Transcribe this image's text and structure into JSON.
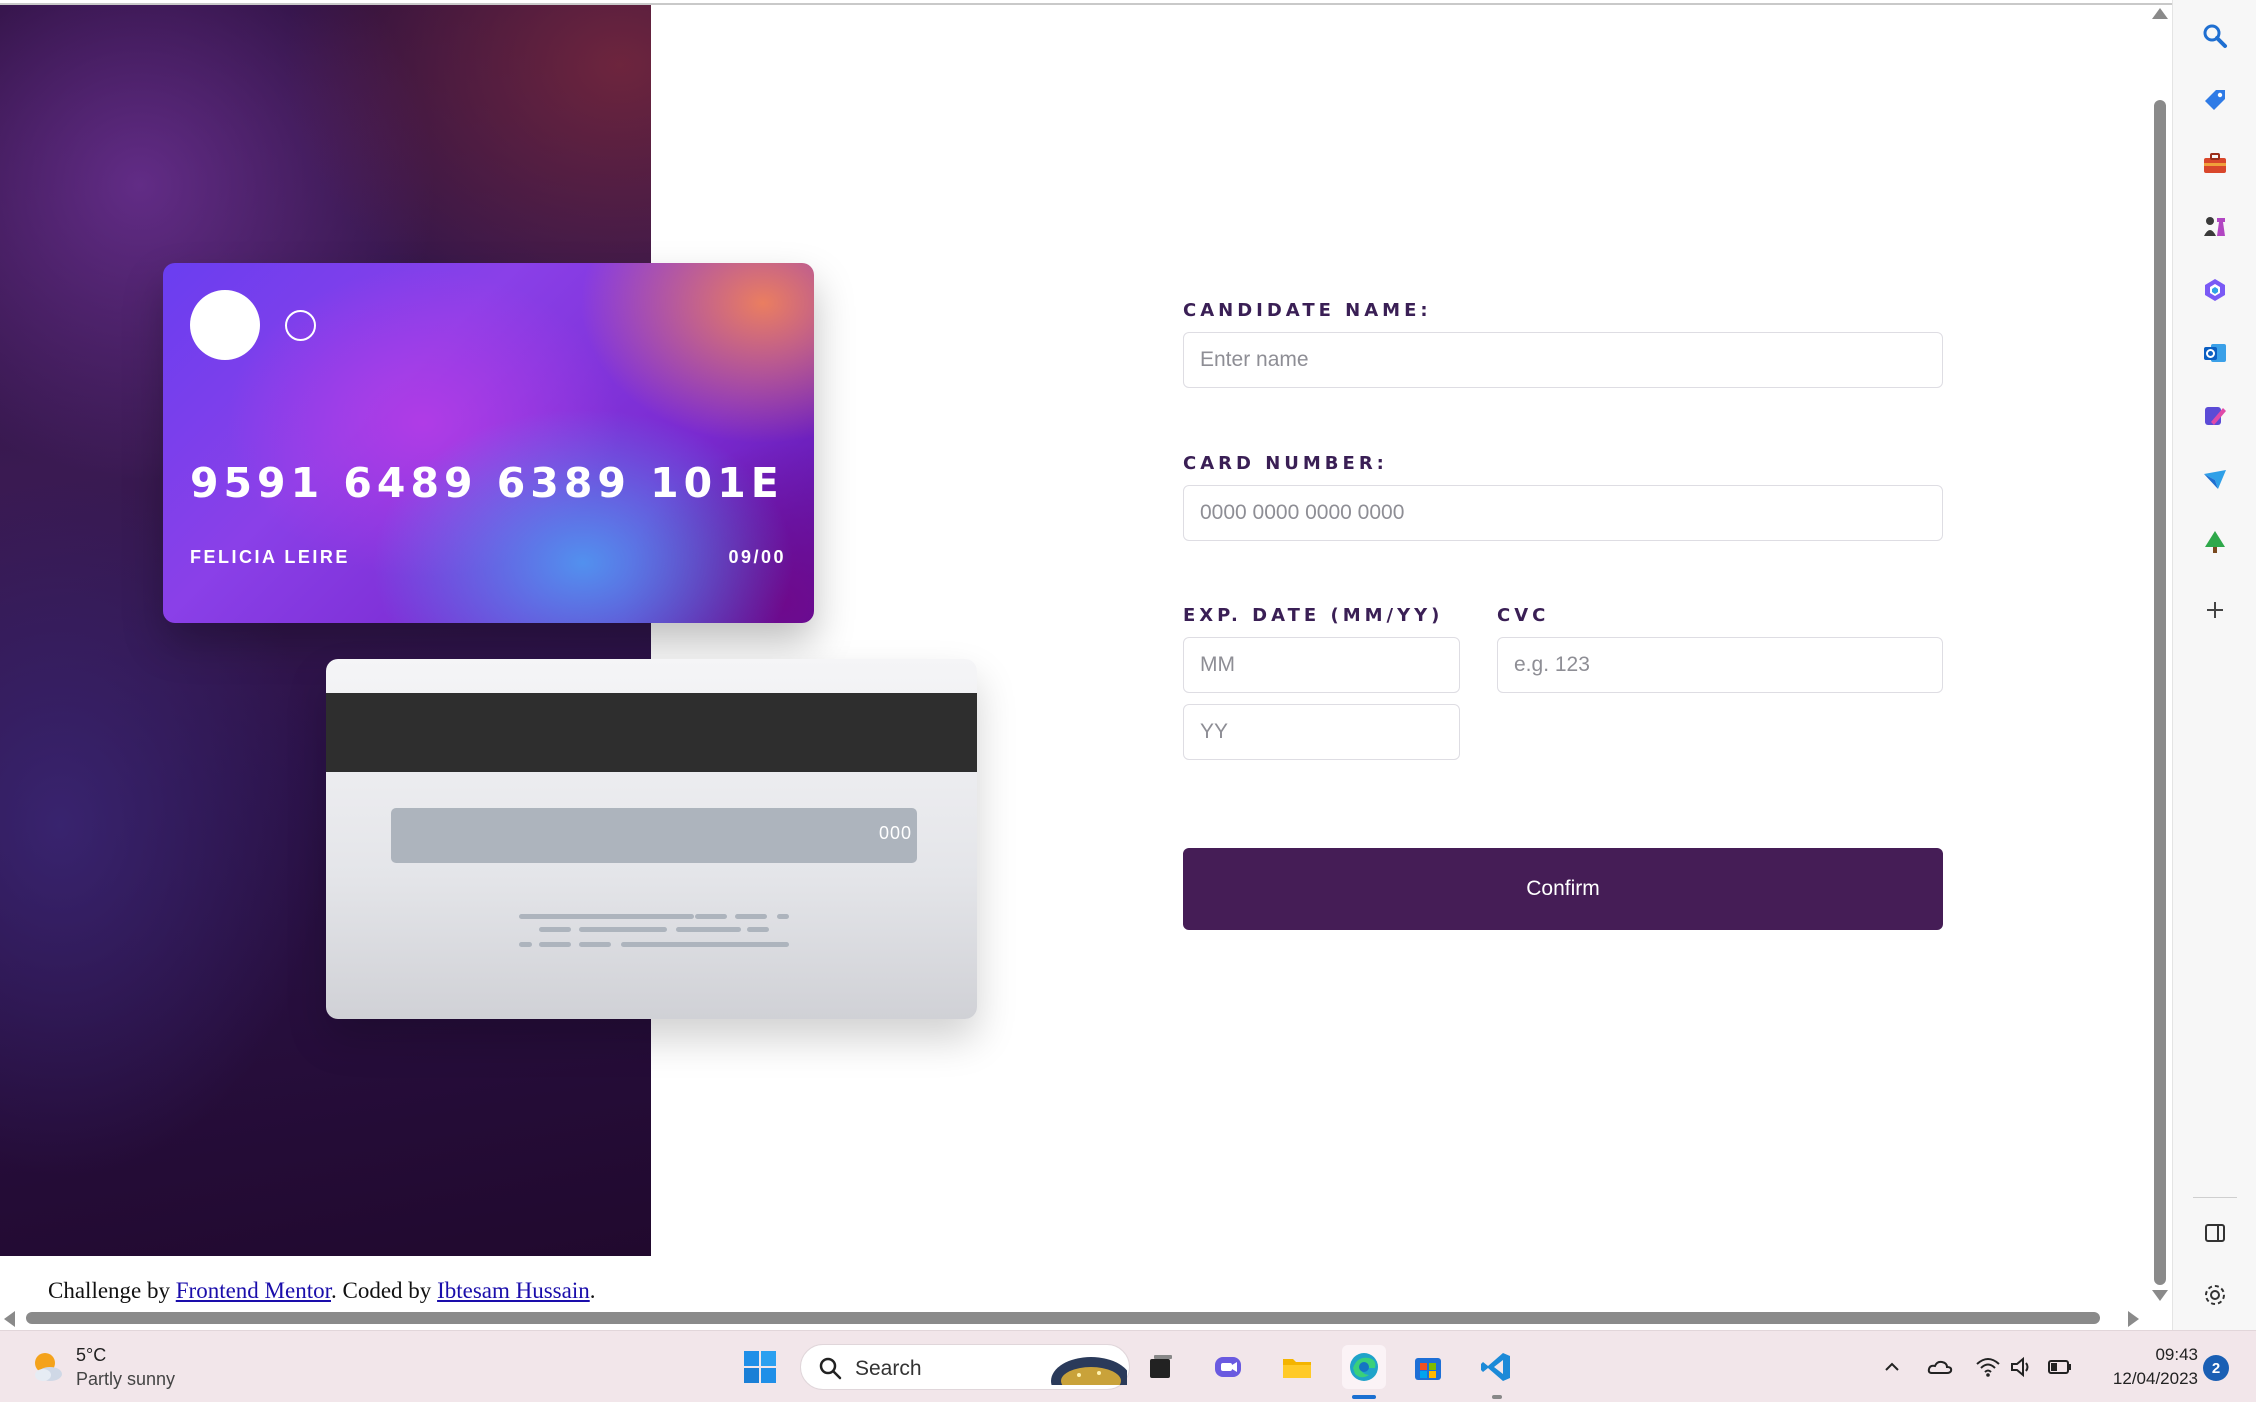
{
  "card_front": {
    "number": "9591 6489 6389 101E",
    "holder": "FELICIA LEIRE",
    "expiry": "09/00"
  },
  "card_back": {
    "cvc": "000"
  },
  "form": {
    "name_label": "CANDIDATE NAME:",
    "name_placeholder": "Enter name",
    "card_number_label": "CARD NUMBER:",
    "card_number_placeholder": "0000 0000 0000 0000",
    "exp_label": "EXP. DATE (MM/YY)",
    "month_placeholder": "MM",
    "year_placeholder": "YY",
    "cvc_label": "CVC",
    "cvc_placeholder": "e.g. 123",
    "confirm_label": "Confirm"
  },
  "attribution": {
    "prefix": "Challenge by ",
    "link1": "Frontend Mentor",
    "middle": ". Coded by ",
    "link2": "Ibtesam Hussain",
    "suffix": "."
  },
  "colors": {
    "accent": "#451d56",
    "label": "#3a1f55",
    "link": "#1a0dab"
  },
  "edge_sidebar": {
    "icons": [
      "search-icon",
      "tag-icon",
      "toolbox-icon",
      "chess-icon",
      "copilot-icon",
      "outlook-icon",
      "designer-icon",
      "send-icon",
      "tree-icon",
      "add-icon",
      "split-view-icon",
      "settings-icon"
    ]
  },
  "taskbar": {
    "weather_temp": "5°C",
    "weather_desc": "Partly sunny",
    "search_label": "Search",
    "time": "09:43",
    "date": "12/04/2023",
    "notification_count": "2"
  }
}
